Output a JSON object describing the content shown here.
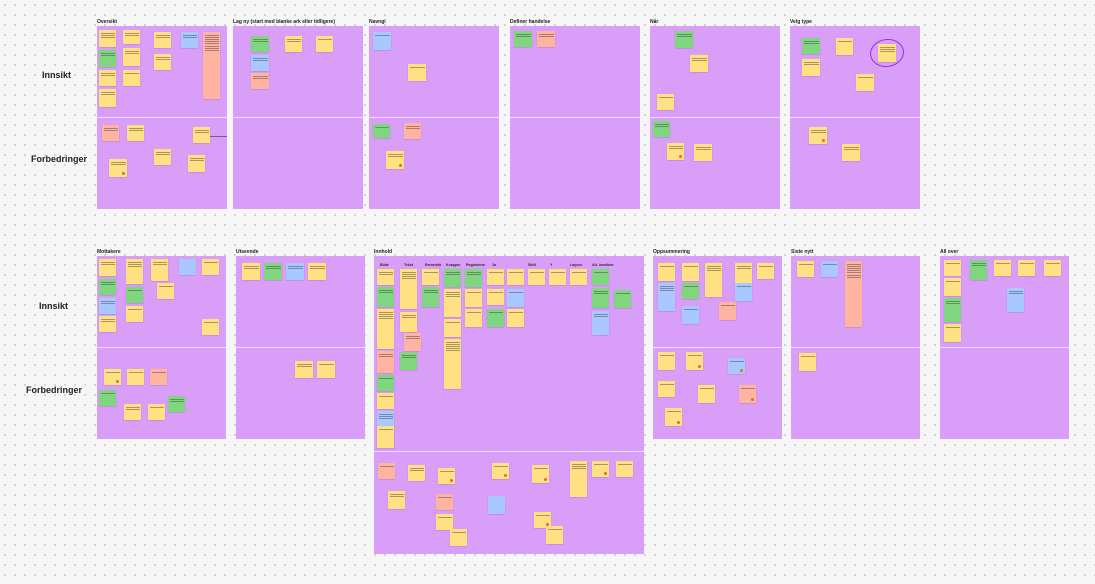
{
  "row_labels": {
    "insikt": "Innsikt",
    "forbedringer": "Forbedringer"
  },
  "boards": {
    "oversikt": "Oversikt",
    "lag_ny": "Lag ny (start med blanke ark eller tidligere)",
    "navngi": "Navngi",
    "definer": "Definer handelse",
    "nar": "Når",
    "velg_type": "Velg type",
    "mottakere": "Mottakere",
    "utseende": "Utseende",
    "innhold": "Innhold",
    "oppsummering": "Oppsummering",
    "siste_nytt": "Siste nytt",
    "all_over": "All over"
  },
  "innhold_columns": {
    "c1": "Bilde",
    "c2": "Tekst",
    "c3": "Emneinfo",
    "c4": "Knapper",
    "c5": "Registrerte",
    "c6": "Ja",
    "c7": "Skift",
    "c8": "Y",
    "c9": "Layout",
    "c10": "Alt. innsikter"
  },
  "colors": {
    "board": "#d99ef8",
    "yellow": "#ffe082",
    "green": "#7fd67f",
    "blue": "#a9c8ff",
    "pink": "#ffb3a1",
    "mark": "#9d2fd6"
  },
  "icons": {
    "highlight": "circle-highlight-icon",
    "reaction": "reaction-dot-icon"
  }
}
